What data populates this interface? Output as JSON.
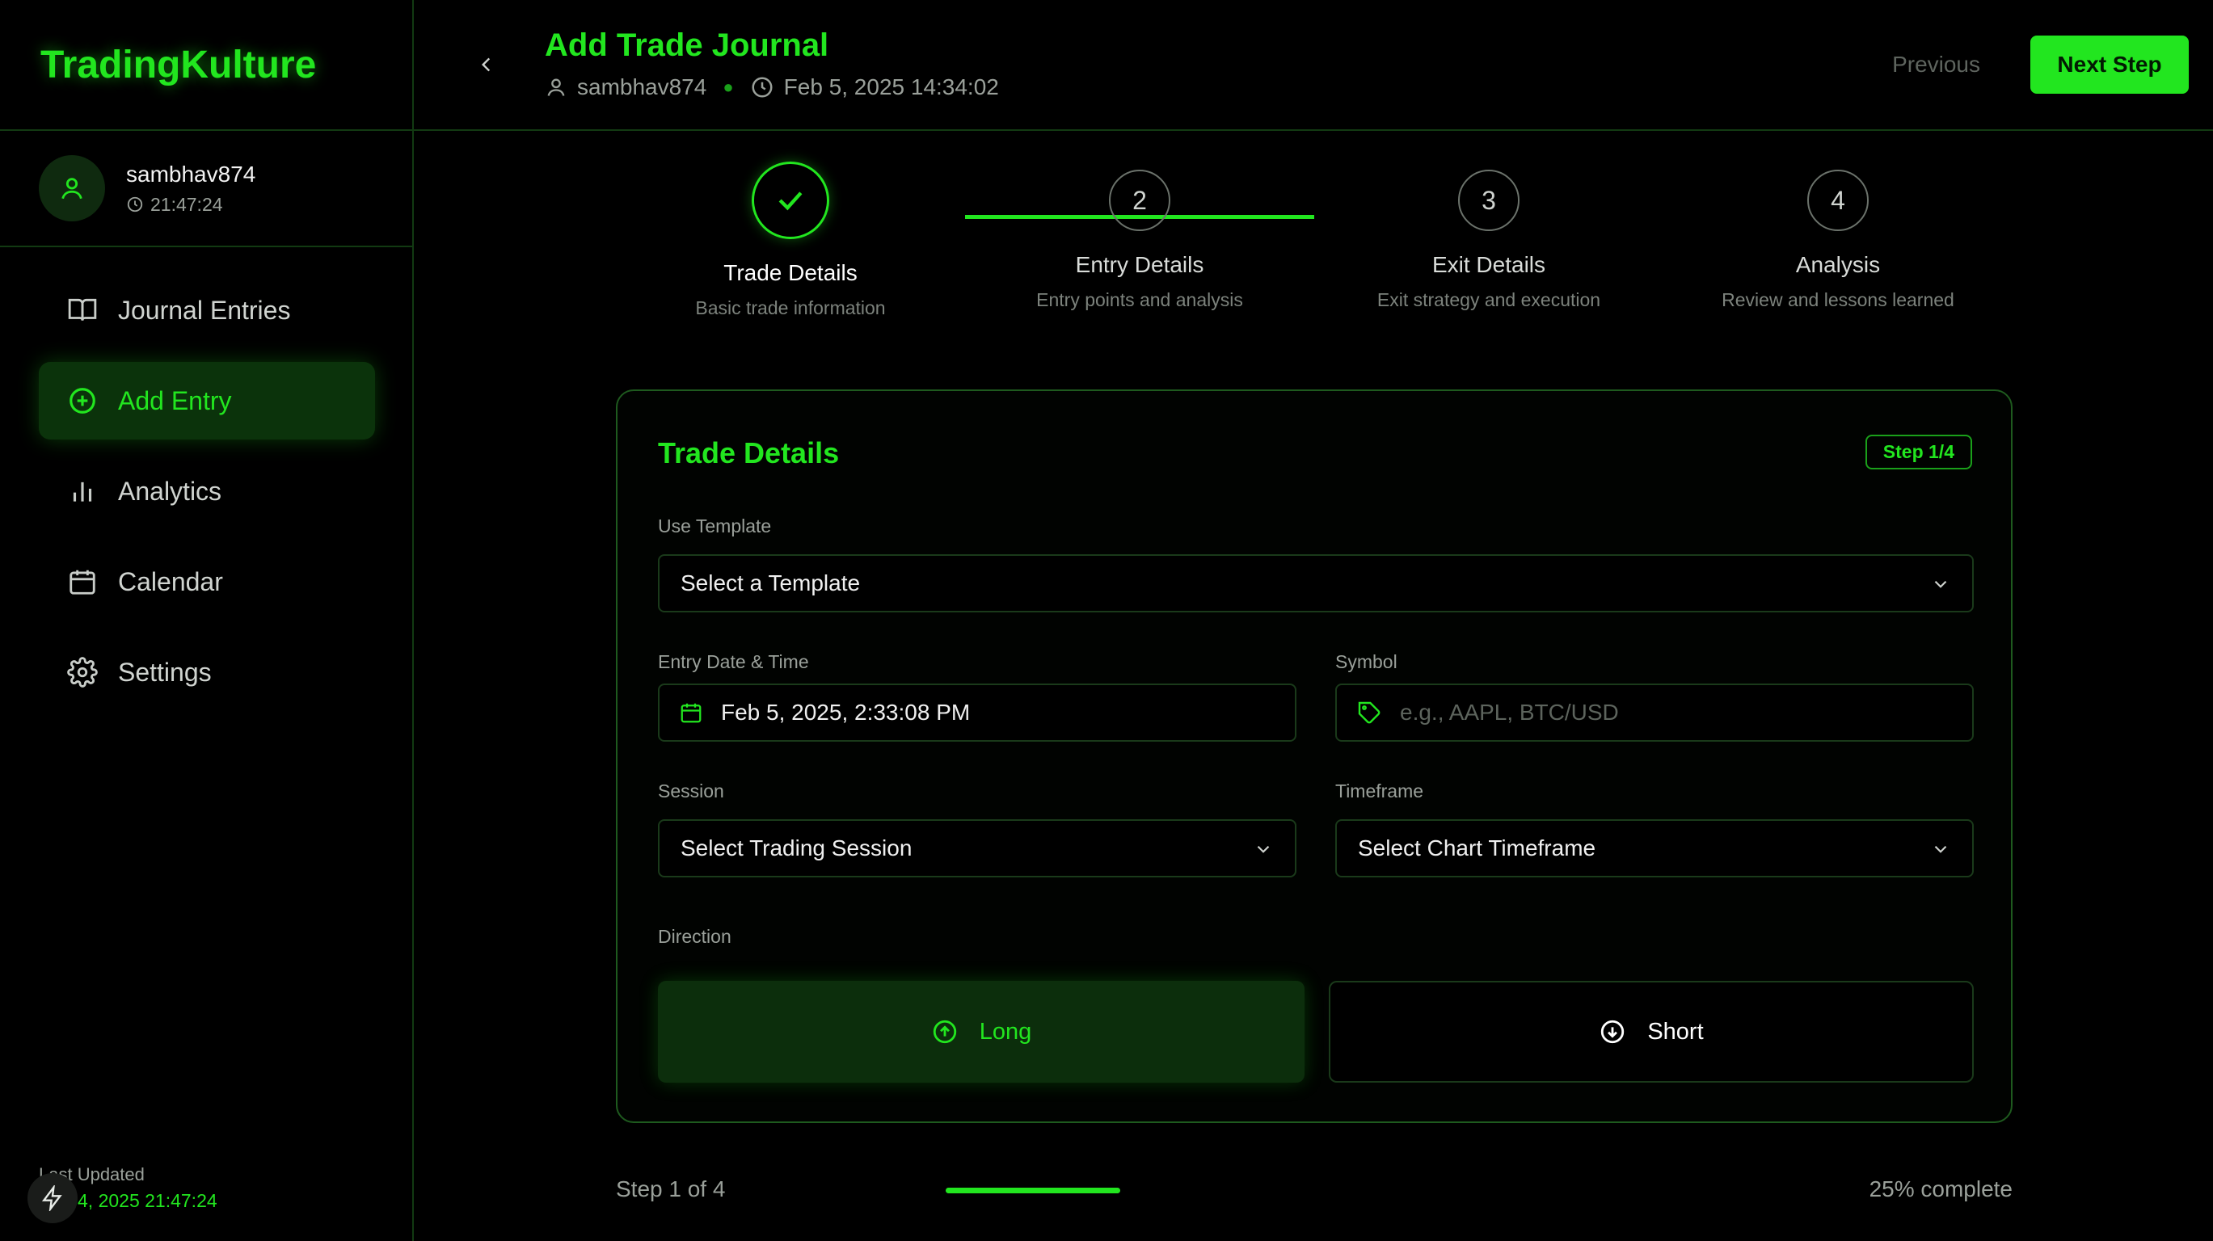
{
  "app": {
    "brand": "TradingKulture"
  },
  "user": {
    "name": "sambhav874",
    "clock": "21:47:24"
  },
  "nav": {
    "items": [
      {
        "label": "Journal Entries",
        "icon": "book-open-icon"
      },
      {
        "label": "Add Entry",
        "icon": "plus-circle-icon",
        "active": true
      },
      {
        "label": "Analytics",
        "icon": "bar-chart-icon"
      },
      {
        "label": "Calendar",
        "icon": "calendar-icon"
      },
      {
        "label": "Settings",
        "icon": "gear-icon"
      }
    ]
  },
  "footer": {
    "label": "Last Updated",
    "date": "4, 2025 21:47:24"
  },
  "header": {
    "title": "Add Trade Journal",
    "user": "sambhav874",
    "datetime": "Feb 5, 2025 14:34:02",
    "prev_label": "Previous",
    "next_label": "Next Step"
  },
  "steps": [
    {
      "number": "1",
      "label": "Trade Details",
      "sub": "Basic trade information",
      "status": "done"
    },
    {
      "number": "2",
      "label": "Entry Details",
      "sub": "Entry points and analysis",
      "status": "pending"
    },
    {
      "number": "3",
      "label": "Exit Details",
      "sub": "Exit strategy and execution",
      "status": "pending"
    },
    {
      "number": "4",
      "label": "Analysis",
      "sub": "Review and lessons learned",
      "status": "pending"
    }
  ],
  "form": {
    "title": "Trade Details",
    "badge": "Step 1/4",
    "template": {
      "label": "Use Template",
      "value": "Select a Template"
    },
    "entry_datetime": {
      "label": "Entry Date & Time",
      "value": "Feb 5, 2025, 2:33:08 PM"
    },
    "symbol": {
      "label": "Symbol",
      "placeholder": "e.g., AAPL, BTC/USD"
    },
    "session": {
      "label": "Session",
      "value": "Select Trading Session"
    },
    "timeframe": {
      "label": "Timeframe",
      "value": "Select Chart Timeframe"
    },
    "direction": {
      "label": "Direction",
      "long": "Long",
      "short": "Short",
      "selected": "Long"
    }
  },
  "progress": {
    "left": "Step 1 of 4",
    "right": "25% complete",
    "fraction": 0.25
  },
  "colors": {
    "accent": "#22e61f",
    "bg": "#000000"
  }
}
